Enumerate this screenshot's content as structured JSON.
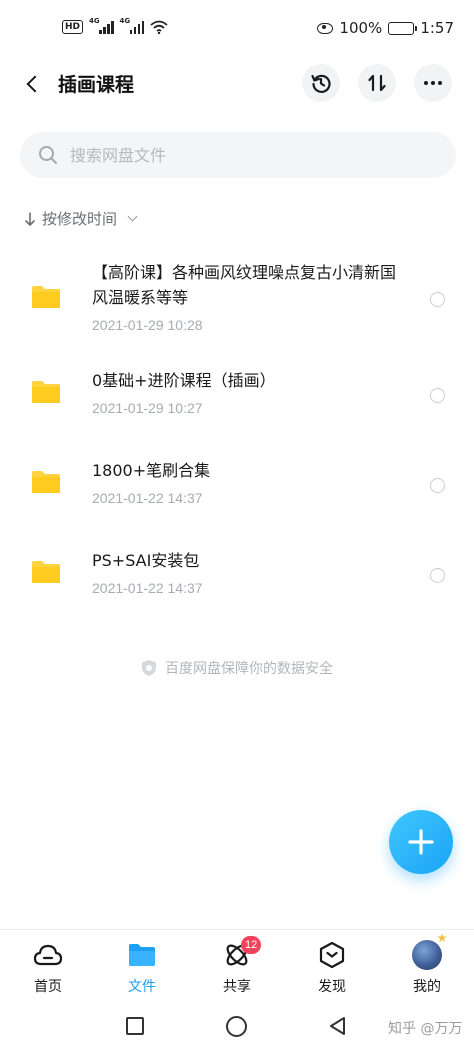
{
  "status_bar": {
    "hd": "HD",
    "sim1": "4G",
    "sim2": "4G",
    "battery": "100%",
    "time": "1:57"
  },
  "header": {
    "title": "插画课程",
    "icons": [
      "back-arrow-icon",
      "history-icon",
      "sort-icon",
      "more-icon"
    ]
  },
  "search": {
    "placeholder": "搜索网盘文件"
  },
  "sort": {
    "label": "按修改时间"
  },
  "files": [
    {
      "name": "【高阶课】各种画风纹理噪点复古小清新国风温暖系等等",
      "date": "2021-01-29  10:28"
    },
    {
      "name": "0基础+进阶课程（插画）",
      "date": "2021-01-29  10:27"
    },
    {
      "name": "1800+笔刷合集",
      "date": "2021-01-22  14:37"
    },
    {
      "name": "PS+SAI安装包",
      "date": "2021-01-22  14:37"
    }
  ],
  "safety_note": "百度网盘保障你的数据安全",
  "tabs": [
    {
      "label": "首页",
      "icon": "cloud-icon"
    },
    {
      "label": "文件",
      "icon": "folder-icon",
      "active": true
    },
    {
      "label": "共享",
      "icon": "atom-icon",
      "badge": "12"
    },
    {
      "label": "发现",
      "icon": "hexagon-icon"
    },
    {
      "label": "我的",
      "icon": "avatar"
    }
  ],
  "watermark": "知乎 @万万",
  "colors": {
    "accent": "#1f9ff2",
    "folder": "#ffd23f",
    "badge": "#f4425a"
  }
}
